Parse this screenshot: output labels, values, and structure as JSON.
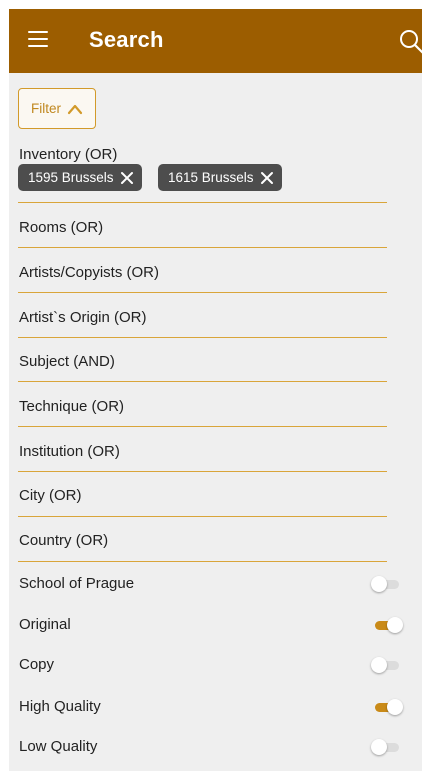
{
  "colors": {
    "app_bar": "#9c5d00",
    "accent": "#d29a2a",
    "toggle_on": "#c98a18"
  },
  "app_bar": {
    "title": "Search",
    "menu_icon": "hamburger-menu-icon",
    "search_icon": "search-icon"
  },
  "filter": {
    "label": "Filter",
    "icon": "chevron-up-icon"
  },
  "inventory": {
    "label": "Inventory (OR)",
    "chips": [
      {
        "label": "1595 Brussels",
        "icon": "close-icon"
      },
      {
        "label": "1615 Brussels",
        "icon": "close-icon"
      }
    ]
  },
  "sections": [
    {
      "label": "Rooms (OR)"
    },
    {
      "label": "Artists/Copyists (OR)"
    },
    {
      "label": "Artist`s Origin (OR)"
    },
    {
      "label": "Subject (AND)"
    },
    {
      "label": "Technique (OR)"
    },
    {
      "label": "Institution (OR)"
    },
    {
      "label": "City (OR)"
    },
    {
      "label": "Country (OR)"
    }
  ],
  "toggles": [
    {
      "label": "School of Prague",
      "on": false
    },
    {
      "label": "Original",
      "on": true
    },
    {
      "label": "Copy",
      "on": false
    },
    {
      "label": "High Quality",
      "on": true
    },
    {
      "label": "Low Quality",
      "on": false
    }
  ]
}
